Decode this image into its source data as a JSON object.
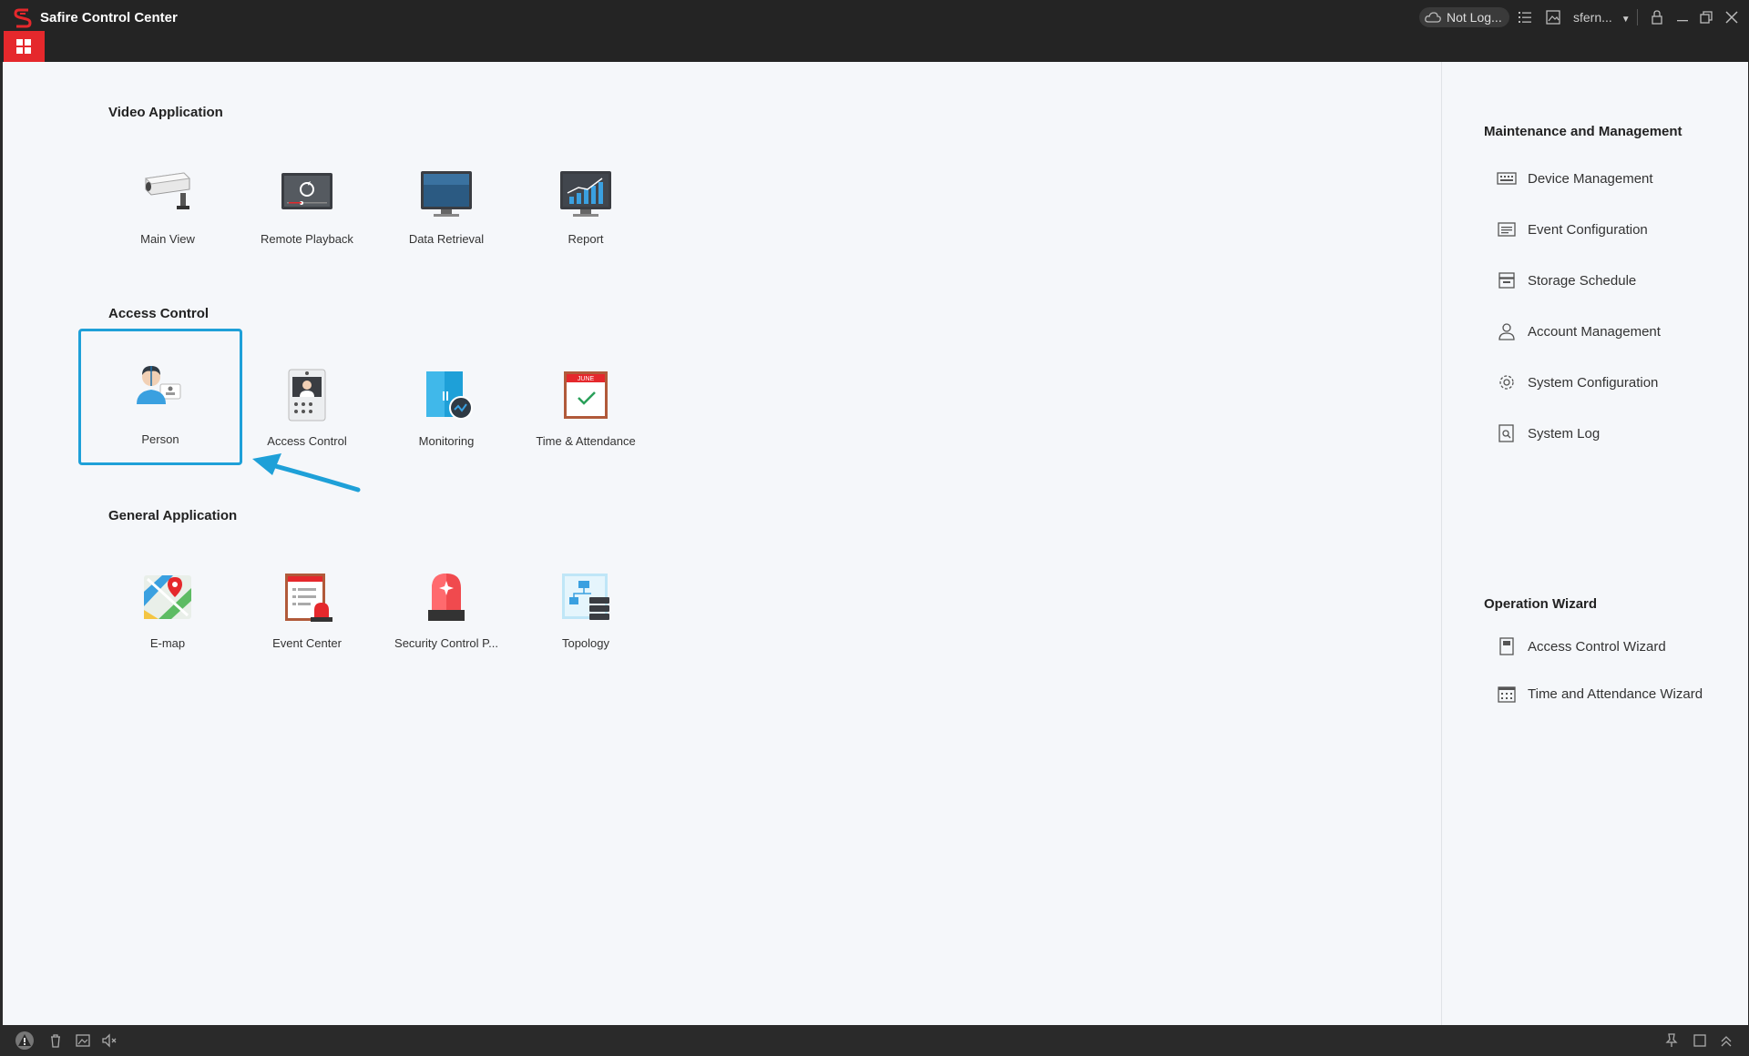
{
  "window": {
    "title": "Safire Control Center",
    "cloud_status": "Not Log...",
    "user": "sfern...",
    "accent": "#e5282c",
    "highlight": "#1ea0d8"
  },
  "main": {
    "sections": [
      {
        "title": "Video Application",
        "tiles": [
          {
            "label": "Main View",
            "icon": "camera-icon"
          },
          {
            "label": "Remote Playback",
            "icon": "playback-monitor-icon"
          },
          {
            "label": "Data Retrieval",
            "icon": "data-monitor-icon"
          },
          {
            "label": "Report",
            "icon": "bar-chart-monitor-icon"
          }
        ]
      },
      {
        "title": "Access Control",
        "tiles": [
          {
            "label": "Person",
            "icon": "person-card-icon"
          },
          {
            "label": "Access Control",
            "icon": "door-intercom-icon"
          },
          {
            "label": "Monitoring",
            "icon": "door-monitor-icon"
          },
          {
            "label": "Time & Attendance",
            "icon": "calendar-icon"
          }
        ]
      },
      {
        "title": "General Application",
        "tiles": [
          {
            "label": "E-map",
            "icon": "map-pin-icon"
          },
          {
            "label": "Event Center",
            "icon": "event-alarm-icon"
          },
          {
            "label": "Security Control P...",
            "icon": "alarm-siren-icon"
          },
          {
            "label": "Topology",
            "icon": "topology-icon"
          }
        ]
      }
    ]
  },
  "right": {
    "maintenance_title": "Maintenance and Management",
    "maintenance_items": [
      {
        "label": "Device Management",
        "icon": "device-icon"
      },
      {
        "label": "Event Configuration",
        "icon": "event-config-icon"
      },
      {
        "label": "Storage Schedule",
        "icon": "storage-icon"
      },
      {
        "label": "Account Management",
        "icon": "user-icon"
      },
      {
        "label": "System Configuration",
        "icon": "gear-icon"
      },
      {
        "label": "System Log",
        "icon": "log-icon"
      }
    ],
    "wizard_title": "Operation Wizard",
    "wizard_items": [
      {
        "label": "Access Control Wizard",
        "icon": "wizard-door-icon"
      },
      {
        "label": "Time and Attendance Wizard",
        "icon": "wizard-calendar-icon"
      }
    ]
  }
}
